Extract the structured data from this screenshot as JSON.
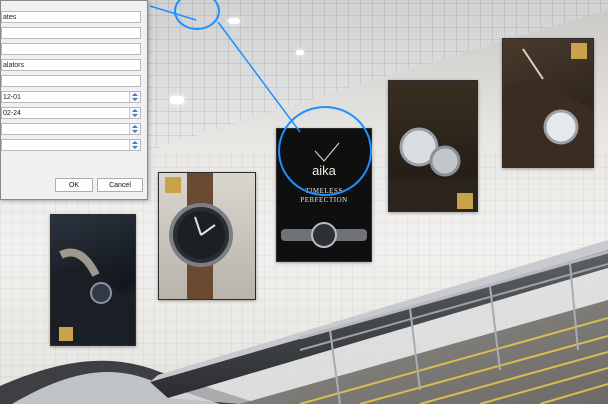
{
  "dialog": {
    "fields": [
      {
        "value": "ates"
      },
      {
        "value": ""
      },
      {
        "value": ""
      },
      {
        "value": "alators"
      },
      {
        "value": ""
      },
      {
        "value": "12-01"
      },
      {
        "value": "02-24"
      },
      {
        "value": ""
      },
      {
        "value": ""
      }
    ],
    "ok_label": "OK",
    "cancel_label": "Cancel"
  },
  "posters": {
    "brand_name": "aika",
    "tagline": "TIMELESS PERFECTION"
  },
  "colors": {
    "accent_ring": "#1e90ff",
    "poster_gold": "#c9a24a",
    "spin_arrow": "#3a7bd5"
  }
}
